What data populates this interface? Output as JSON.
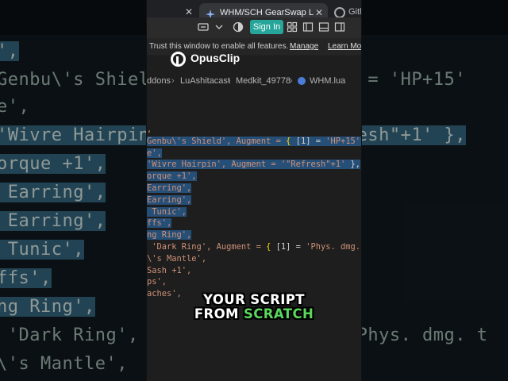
{
  "browser": {
    "active_tab_title": "WHM/SCH GearSwap Lua fi",
    "other_tab_label": "Githu",
    "sign_in_label": "Sign In",
    "colors": {
      "sign_in_bg": "#26a69a"
    }
  },
  "trust_bar": {
    "message": "Trust this window to enable all features.",
    "manage_label": "Manage",
    "learn_more_label": "Learn Mor"
  },
  "watermark": {
    "text": "OpusClip"
  },
  "breadcrumb": {
    "items": [
      "ddons",
      "LuAshitacast",
      "Medkit_49778",
      "WHM.lua"
    ]
  },
  "code_lines": [
    {
      "a": ",",
      "b": ""
    },
    {
      "a": "Genbu\\'s Shield', Augment = ",
      "brace": "{",
      "c": " [1] = ",
      "s": "'HP+15',",
      "sel": true
    },
    {
      "a": "e',",
      "sel": true
    },
    {
      "a": "'Wivre Hairpin', Augment = ",
      "s": "'\"Refresh\"+1'",
      "tail": " },",
      "sel": true
    },
    {
      "a": "orque +1',",
      "sel": true
    },
    {
      "a": "Earring',",
      "sel": true
    },
    {
      "a": "Earring',",
      "sel": true
    },
    {
      "a": " Tunic',",
      "sel": true
    },
    {
      "a": "ffs',",
      "sel": true
    },
    {
      "a": "ng Ring',",
      "sel": true
    },
    {
      "a": " 'Dark Ring', Augment = ",
      "brace": "{",
      "c": " [1] = ",
      "s": "'Phys. dmg. t",
      "sel": false
    },
    {
      "a": "\\'s Mantle',",
      "sel": false
    },
    {
      "a": "Sash +1',",
      "sel": false
    },
    {
      "a": "ps',",
      "sel": false
    },
    {
      "a": "aches',",
      "sel": false
    }
  ],
  "background_code": {
    "lines": [
      "',",
      "Genbu\\'s Shield', Augment = { [1] = 'HP+15'",
      "e',",
      "'Wivre Hairpin', Augment = '\"Refresh\"+1' },",
      "orque +1',",
      " Earring',",
      " Earring',",
      " Tunic',",
      "ffs',",
      "ng Ring',",
      " 'Dark Ring', Augment = { [1] = 'Phys. dmg. t",
      "\\'s Mantle',"
    ]
  },
  "caption": {
    "line1": "YOUR SCRIPT",
    "line2_prefix": "FROM ",
    "line2_highlight": "SCRATCH",
    "colors": {
      "highlight": "#5cd65c"
    }
  }
}
